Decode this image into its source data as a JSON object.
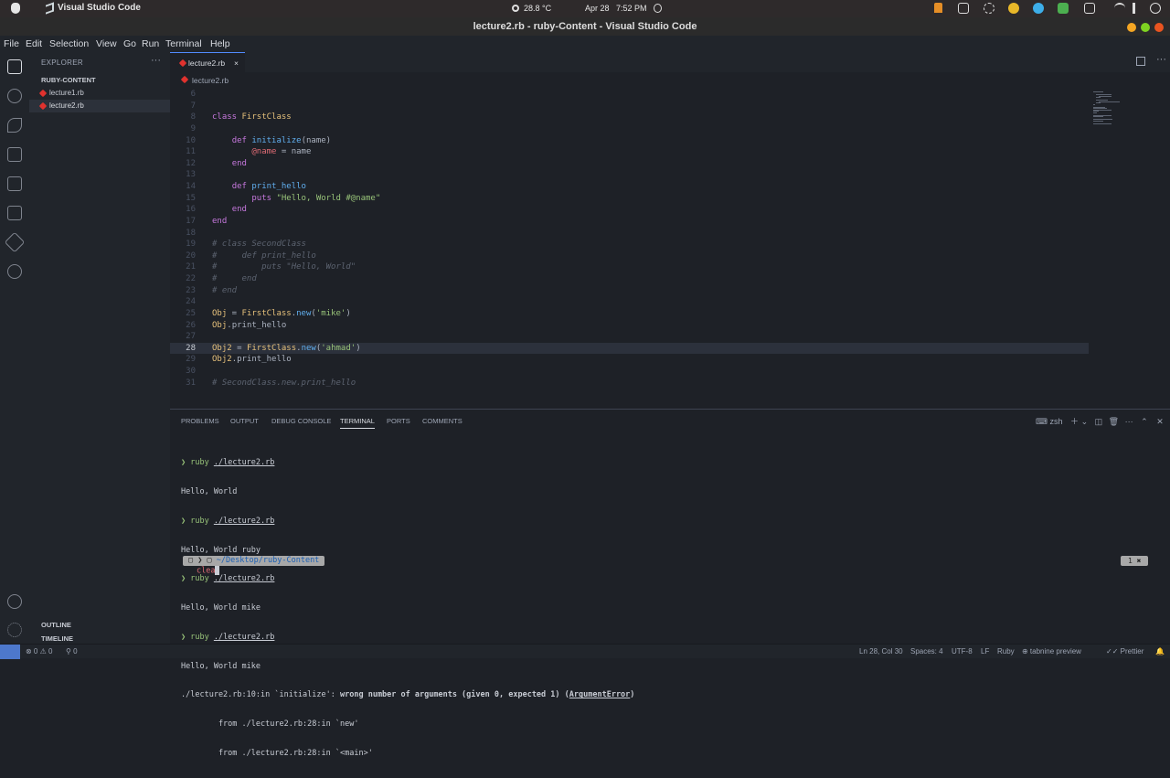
{
  "os_bar": {
    "app_name": "Visual Studio Code",
    "temperature": "28.8 °C",
    "date": "Apr 28",
    "time": "7:52 PM"
  },
  "window": {
    "title": "lecture2.rb - ruby-Content - Visual Studio Code"
  },
  "menu": [
    "File",
    "Edit",
    "Selection",
    "View",
    "Go",
    "Run",
    "Terminal",
    "Help"
  ],
  "sidebar": {
    "header": "EXPLORER",
    "more": "···",
    "folder": "RUBY-CONTENT",
    "files": [
      "lecture1.rb",
      "lecture2.rb"
    ],
    "outline": "OUTLINE",
    "timeline": "TIMELINE"
  },
  "tab": {
    "label": "lecture2.rb",
    "close": "×"
  },
  "breadcrumb": "lecture2.rb",
  "editor": {
    "current_line": "28",
    "lines": [
      {
        "n": "6",
        "t": ""
      },
      {
        "n": "7",
        "t": ""
      },
      {
        "n": "8",
        "t": "class FirstClass"
      },
      {
        "n": "9",
        "t": ""
      },
      {
        "n": "10",
        "t": "    def initialize(name)"
      },
      {
        "n": "11",
        "t": "        @name = name"
      },
      {
        "n": "12",
        "t": "    end"
      },
      {
        "n": "13",
        "t": ""
      },
      {
        "n": "14",
        "t": "    def print_hello"
      },
      {
        "n": "15",
        "t": "        puts \"Hello, World #@name\""
      },
      {
        "n": "16",
        "t": "    end"
      },
      {
        "n": "17",
        "t": "end"
      },
      {
        "n": "18",
        "t": ""
      },
      {
        "n": "19",
        "t": "# class SecondClass"
      },
      {
        "n": "20",
        "t": "#     def print_hello"
      },
      {
        "n": "21",
        "t": "#         puts \"Hello, World\""
      },
      {
        "n": "22",
        "t": "#     end"
      },
      {
        "n": "23",
        "t": "# end"
      },
      {
        "n": "24",
        "t": ""
      },
      {
        "n": "25",
        "t": "Obj = FirstClass.new('mike')"
      },
      {
        "n": "26",
        "t": "Obj.print_hello"
      },
      {
        "n": "27",
        "t": ""
      },
      {
        "n": "28",
        "t": "Obj2 = FirstClass.new('ahmad')"
      },
      {
        "n": "29",
        "t": "Obj2.print_hello"
      },
      {
        "n": "30",
        "t": ""
      },
      {
        "n": "31",
        "t": "# SecondClass.new.print_hello"
      }
    ]
  },
  "panel": {
    "tabs": [
      "PROBLEMS",
      "OUTPUT",
      "DEBUG CONSOLE",
      "TERMINAL",
      "PORTS",
      "COMMENTS"
    ],
    "active_tab": "TERMINAL",
    "shell": "zsh",
    "terminal": {
      "prompt_symbol": "❯",
      "cmd": "ruby",
      "file": "./lecture2.rb",
      "out1": "Hello, World",
      "out2": "Hello, World ruby",
      "out3": "Hello, World mike",
      "out4": "Hello, World mike",
      "err_prefix": "./lecture2.rb:10:in `initialize': ",
      "err_msg": "wrong number of arguments (given 0, expected 1) (",
      "err_class": "ArgumentError",
      "err_close": ")",
      "trace1": "        from ./lecture2.rb:28:in `new'",
      "trace2": "        from ./lecture2.rb:28:in `<main>'",
      "path": "~/Desktop/ruby-Content",
      "typed": "clea",
      "right_badge": "1 ✖"
    }
  },
  "status": {
    "errors": "⊗ 0 ⚠ 0",
    "ports": "⚲ 0",
    "position": "Ln 28, Col 30",
    "spaces": "Spaces: 4",
    "encoding": "UTF-8",
    "eol": "LF",
    "language": "Ruby",
    "tabnine": "⊕ tabnine preview",
    "prettier": "✓✓ Prettier"
  }
}
